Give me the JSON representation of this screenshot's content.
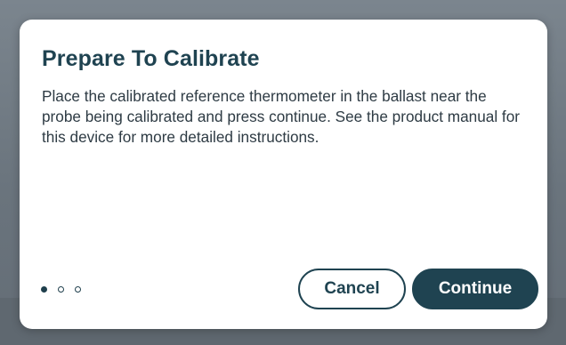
{
  "dialog": {
    "title": "Prepare To Calibrate",
    "body": "Place the calibrated reference thermometer in the ballast near the probe being calibrated and press continue. See the product manual for this device for more detailed instructions.",
    "pager": {
      "total_steps": 3,
      "current_step": 1
    },
    "buttons": {
      "cancel_label": "Cancel",
      "continue_label": "Continue"
    }
  },
  "colors": {
    "accent": "#1f4351",
    "backdrop": "#6d7780",
    "dialog_background": "#ffffff"
  }
}
